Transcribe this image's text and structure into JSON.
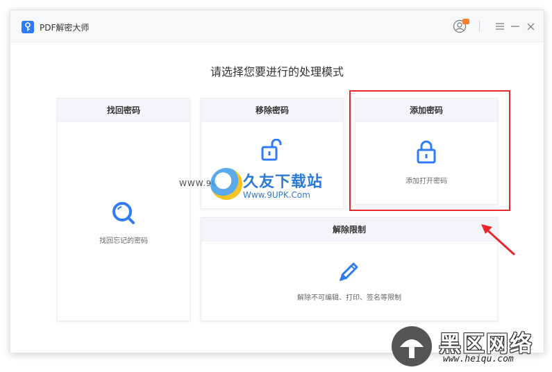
{
  "window": {
    "title": "PDF解密大师",
    "controls": [
      "menu-icon",
      "minimize-icon",
      "close-icon"
    ]
  },
  "main": {
    "heading": "请选择您要进行的处理模式"
  },
  "cards": {
    "find": {
      "title": "找回密码",
      "desc": "找回忘记的密码",
      "icon": "search-icon"
    },
    "remove": {
      "title": "移除密码",
      "icon": "unlock-icon"
    },
    "add": {
      "title": "添加密码",
      "desc": "添加打开密码",
      "icon": "lock-icon"
    },
    "unlock": {
      "title": "解除限制",
      "desc": "解除不可编辑、打印、签名等限制",
      "icon": "pencil-icon"
    }
  },
  "watermarks": {
    "site1_prefix": "WWW.9U",
    "site1_name": "久友下载站",
    "site1_url": "Www.9UPK.Com",
    "site2_name": "黑区网络",
    "site2_url": "www.heiqu.com"
  },
  "colors": {
    "accent": "#2f7bf5",
    "highlight": "#e8282b",
    "card_header": "#f4f6fb"
  }
}
